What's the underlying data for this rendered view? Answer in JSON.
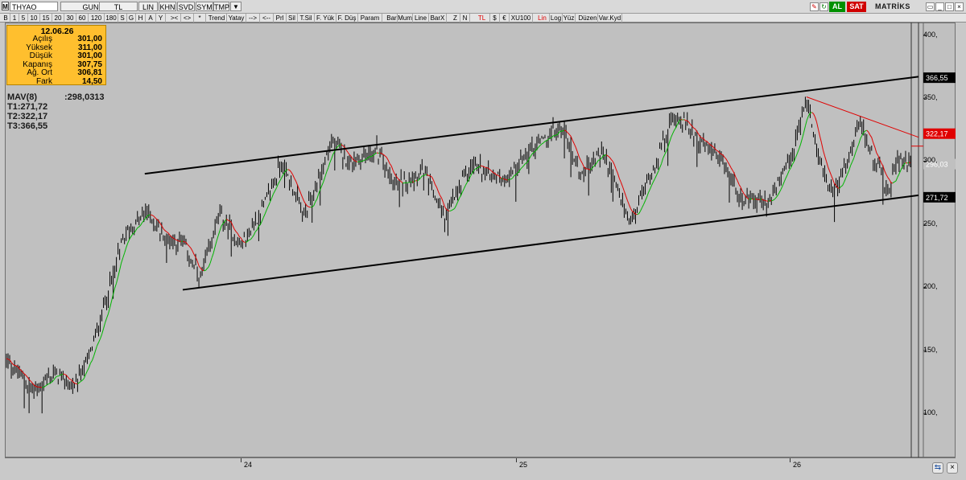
{
  "titlebar": {
    "symbol": "THYAO",
    "period": "GUN",
    "currency": "TL",
    "scale": "LIN",
    "buttons": [
      "KHN",
      "SVD",
      "SYM",
      "TMP"
    ],
    "buy_label": "AL",
    "sell_label": "SAT",
    "brand": "MATRİKS"
  },
  "toolbar": {
    "items": [
      "B",
      "1",
      "5",
      "10",
      "15",
      "20",
      "30",
      "60",
      "120",
      "180",
      "S",
      "G",
      "H",
      "A",
      "Y",
      "><",
      "<>",
      "*",
      "Trend",
      "Yatay",
      "-->",
      "<--",
      "Prl",
      "Sil",
      "T.Sil",
      "F. Yük",
      "F. Düş",
      "Param",
      "Bar",
      "Mum",
      "Line",
      "BarX",
      "Z",
      "N",
      "TL",
      "$",
      "€",
      "XU100",
      "Lin",
      "Log",
      "Yüz",
      "Düzen",
      "Var.Kyd"
    ]
  },
  "info_box": {
    "date": "12.06.26",
    "rows": [
      {
        "label": "Açılış",
        "value": "301,00"
      },
      {
        "label": "Yüksek",
        "value": "311,00"
      },
      {
        "label": "Düşük",
        "value": "301,00"
      },
      {
        "label": "Kapanış",
        "value": "307,75"
      },
      {
        "label": "Ağ. Ort",
        "value": "306,81"
      },
      {
        "label": "Fark",
        "value": "14,50"
      }
    ]
  },
  "indicators": {
    "mav_label": "MAV(8)",
    "mav_value": ":298,0313",
    "t1": "T1:271,72",
    "t2": "T2:322,17",
    "t3": "T3:366,55"
  },
  "colors": {
    "rising_ma": "#00b400",
    "falling_ma": "#e00000",
    "t2_target": "#e00000",
    "info_box_bg": "#ffbf2e",
    "buy_button": "#009000",
    "sell_button": "#d00000"
  },
  "chart_data": {
    "type": "bar",
    "style": "OHLC daily bars with MAV(8) moving average colored green when rising and red when falling",
    "ylim": [
      65,
      410
    ],
    "yticks": [
      100,
      150,
      200,
      250,
      300,
      350,
      400
    ],
    "ytick_labels": [
      "100,",
      "150,",
      "200,",
      "250,",
      "300,",
      "350,",
      "400,"
    ],
    "xtick_labels": [
      "24",
      "25",
      "26"
    ],
    "grid": false,
    "price_path": [
      {
        "x": 0.0,
        "y": 142
      },
      {
        "x": 0.03,
        "y": 118
      },
      {
        "x": 0.055,
        "y": 132
      },
      {
        "x": 0.075,
        "y": 120
      },
      {
        "x": 0.095,
        "y": 152
      },
      {
        "x": 0.13,
        "y": 240
      },
      {
        "x": 0.155,
        "y": 260
      },
      {
        "x": 0.175,
        "y": 240
      },
      {
        "x": 0.195,
        "y": 235
      },
      {
        "x": 0.215,
        "y": 205
      },
      {
        "x": 0.235,
        "y": 258
      },
      {
        "x": 0.26,
        "y": 232
      },
      {
        "x": 0.285,
        "y": 265
      },
      {
        "x": 0.305,
        "y": 300
      },
      {
        "x": 0.33,
        "y": 255
      },
      {
        "x": 0.36,
        "y": 316
      },
      {
        "x": 0.38,
        "y": 299
      },
      {
        "x": 0.41,
        "y": 308
      },
      {
        "x": 0.43,
        "y": 280
      },
      {
        "x": 0.46,
        "y": 292
      },
      {
        "x": 0.485,
        "y": 255
      },
      {
        "x": 0.515,
        "y": 298
      },
      {
        "x": 0.55,
        "y": 285
      },
      {
        "x": 0.585,
        "y": 312
      },
      {
        "x": 0.615,
        "y": 327
      },
      {
        "x": 0.635,
        "y": 290
      },
      {
        "x": 0.66,
        "y": 308
      },
      {
        "x": 0.69,
        "y": 250
      },
      {
        "x": 0.715,
        "y": 294
      },
      {
        "x": 0.74,
        "y": 338
      },
      {
        "x": 0.765,
        "y": 318
      },
      {
        "x": 0.795,
        "y": 295
      },
      {
        "x": 0.815,
        "y": 268
      },
      {
        "x": 0.845,
        "y": 268
      },
      {
        "x": 0.87,
        "y": 305
      },
      {
        "x": 0.885,
        "y": 350
      },
      {
        "x": 0.9,
        "y": 300
      },
      {
        "x": 0.915,
        "y": 272
      },
      {
        "x": 0.93,
        "y": 300
      },
      {
        "x": 0.945,
        "y": 330
      },
      {
        "x": 0.96,
        "y": 302
      },
      {
        "x": 0.975,
        "y": 274
      },
      {
        "x": 0.985,
        "y": 300
      },
      {
        "x": 1.0,
        "y": 298
      }
    ],
    "trend_channel": {
      "upper": {
        "from": {
          "x": 0.153,
          "y": 290
        },
        "to": {
          "x": 1.0,
          "y": 367
        }
      },
      "lower": {
        "from": {
          "x": 0.195,
          "y": 198
        },
        "to": {
          "x": 1.0,
          "y": 273
        }
      }
    },
    "red_trendline": {
      "from": {
        "x": 0.885,
        "y": 351
      },
      "to": {
        "x": 1.0,
        "y": 319
      }
    },
    "targets": [
      {
        "name": "T3",
        "value": 366.55,
        "label": "366,55"
      },
      {
        "name": "T2",
        "value": 322.17,
        "label": "322,17"
      },
      {
        "name": "last",
        "value": 298.03,
        "label": "298,03"
      },
      {
        "name": "T1",
        "value": 271.72,
        "label": "271,72"
      }
    ]
  }
}
